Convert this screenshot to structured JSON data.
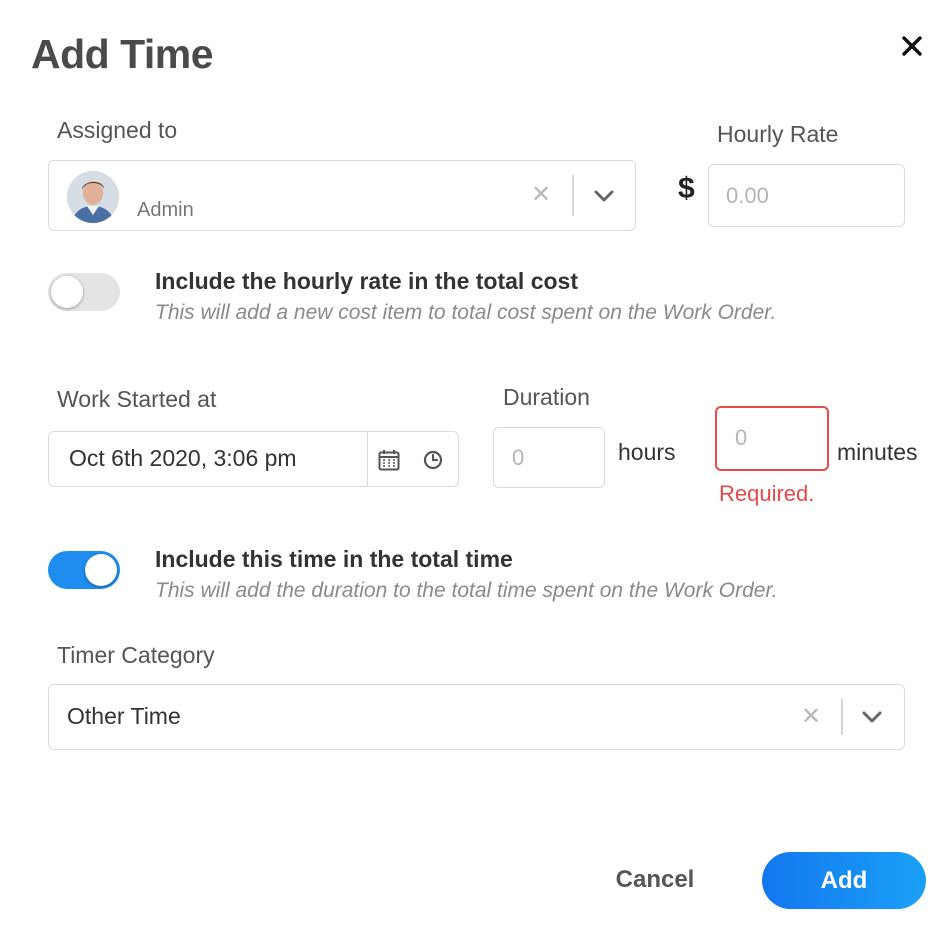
{
  "dialog": {
    "title": "Add Time",
    "close_icon": "close-icon"
  },
  "assigned": {
    "label": "Assigned to",
    "value": "Admin",
    "clear_icon": "clear-icon",
    "dropdown_icon": "chevron-down-icon"
  },
  "rate": {
    "label": "Hourly Rate",
    "currency_symbol": "$",
    "placeholder": "0.00",
    "value": ""
  },
  "include_rate": {
    "title": "Include the hourly rate in the total cost",
    "description": "This will add a new cost item to total cost spent on the Work Order.",
    "enabled": false
  },
  "work_started": {
    "label": "Work Started at",
    "value": "Oct 6th 2020, 3:06 pm",
    "calendar_icon": "calendar-icon",
    "clock_icon": "clock-icon"
  },
  "duration": {
    "label": "Duration",
    "hours_placeholder": "0",
    "hours_unit": "hours",
    "minutes_placeholder": "0",
    "minutes_unit": "minutes",
    "error": "Required."
  },
  "include_time": {
    "title": "Include this time in the total time",
    "description": "This will add the duration to the total time spent on the Work Order.",
    "enabled": true
  },
  "category": {
    "label": "Timer Category",
    "value": "Other Time",
    "clear_icon": "clear-icon",
    "dropdown_icon": "chevron-down-icon"
  },
  "actions": {
    "cancel_label": "Cancel",
    "add_label": "Add"
  },
  "colors": {
    "primary": "#1f8cf0",
    "error": "#e84a4a",
    "toggle_off": "#e4e4e4"
  }
}
